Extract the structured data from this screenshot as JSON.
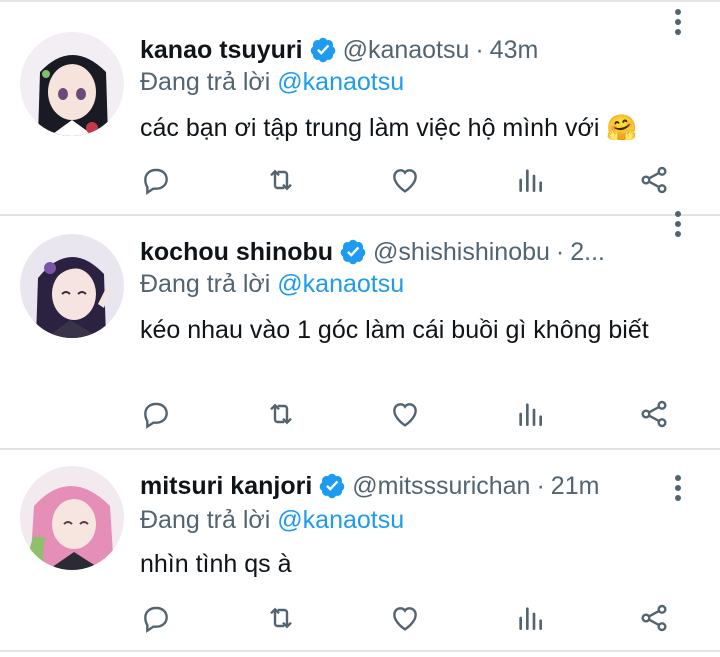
{
  "tweets": [
    {
      "name": "kanao tsuyuri",
      "handle": "@kanaotsu",
      "time": "43m",
      "replying_prefix": "Đang trả lời ",
      "replying_to": "@kanaotsu",
      "text": "các bạn ơi tập trung làm việc hộ mình với 🤗",
      "avatar_colors": {
        "bg": "#f2eef3",
        "hair": "#1a1a24",
        "face": "#f6e3dc",
        "accent": "#c23a4a"
      }
    },
    {
      "name": "kochou shinobu",
      "handle": "@shishishinobu",
      "time": "2...",
      "replying_prefix": "Đang trả lời ",
      "replying_to": "@kanaotsu",
      "text": "kéo nhau vào 1 góc làm cái buồi gì không biết",
      "avatar_colors": {
        "bg": "#e9e6f0",
        "hair": "#2a2240",
        "face": "#f5e4df",
        "accent": "#7a55a8"
      }
    },
    {
      "name": "mitsuri kanjori",
      "handle": "@mitsssurichan",
      "time": "21m",
      "replying_prefix": "Đang trả lời ",
      "replying_to": "@kanaotsu",
      "text": "nhìn tình qs à",
      "avatar_colors": {
        "bg": "#f3eaf0",
        "hair": "#e58fb8",
        "face": "#f7e6e0",
        "accent": "#8fbf6a"
      }
    }
  ],
  "icons": {
    "verified": "verified-badge-icon",
    "reply": "reply-icon",
    "retweet": "retweet-icon",
    "like": "heart-icon",
    "views": "analytics-icon",
    "share": "share-icon",
    "more": "more-vertical-icon"
  },
  "colors": {
    "link": "#1d9bf0",
    "secondary_text": "#536471",
    "primary_text": "#0f1419",
    "verified": "#1d9bf0",
    "separator": "#e3e3e3"
  }
}
